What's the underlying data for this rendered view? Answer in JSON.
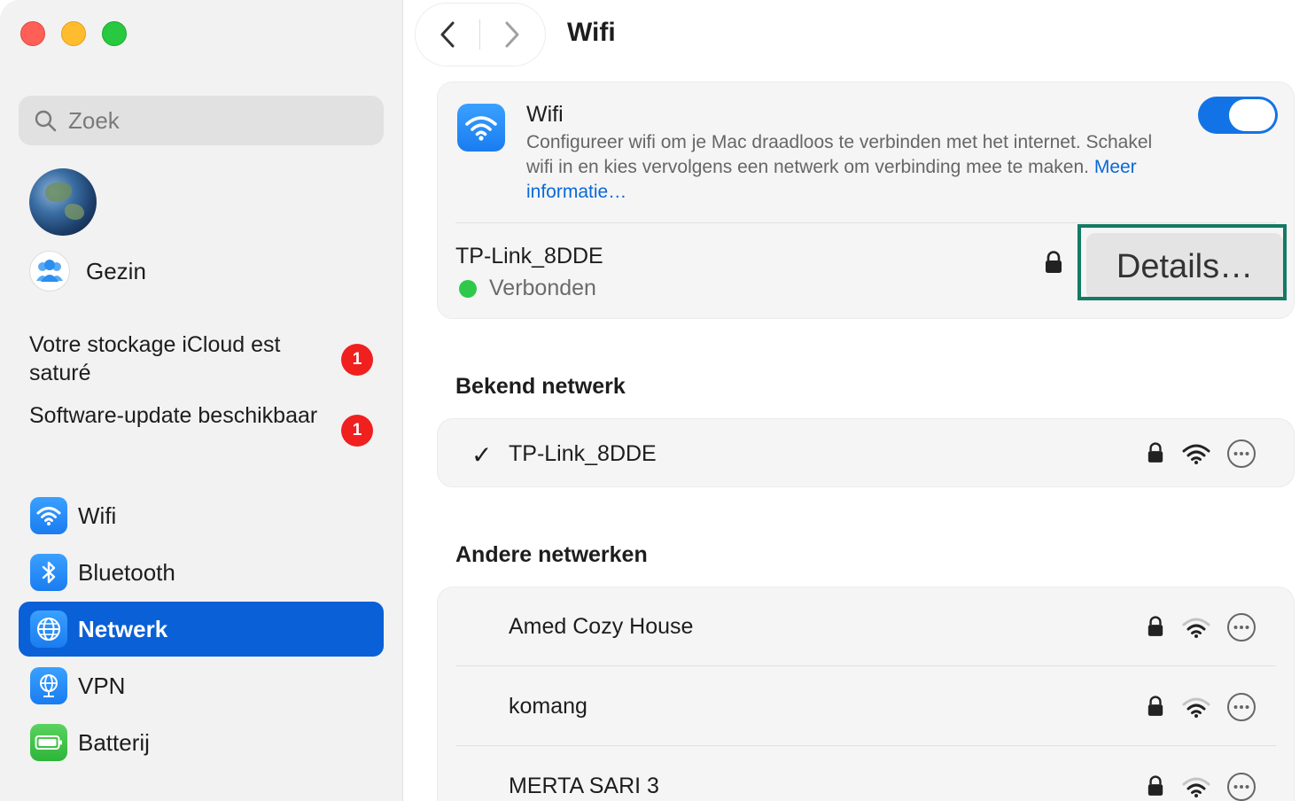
{
  "window": {
    "title": "Wifi"
  },
  "sidebar": {
    "search_placeholder": "Zoek",
    "family_label": "Gezin",
    "notices": [
      {
        "text": "Votre stockage iCloud est saturé",
        "badge": "1"
      },
      {
        "text": "Software-update beschikbaar",
        "badge": "1"
      }
    ],
    "items": [
      {
        "label": "Wifi",
        "icon": "wifi-icon"
      },
      {
        "label": "Bluetooth",
        "icon": "bluetooth-icon"
      },
      {
        "label": "Netwerk",
        "icon": "globe-icon",
        "active": true
      },
      {
        "label": "VPN",
        "icon": "vpn-globe-icon"
      },
      {
        "label": "Batterij",
        "icon": "battery-icon"
      }
    ]
  },
  "wifi": {
    "title": "Wifi",
    "description": "Configureer wifi om je Mac draadloos te verbinden met het internet. Schakel wifi in en kies vervolgens een netwerk om verbinding mee te maken.",
    "more_link": "Meer informatie…",
    "enabled": true,
    "current_network": "TP-Link_8DDE",
    "status": "Verbonden",
    "details_button": "Details…"
  },
  "known": {
    "title": "Bekend netwerk",
    "networks": [
      {
        "name": "TP-Link_8DDE",
        "checked": "✓"
      }
    ]
  },
  "others": {
    "title": "Andere netwerken",
    "networks": [
      {
        "name": "Amed Cozy House"
      },
      {
        "name": "komang"
      },
      {
        "name": "MERTA SARI 3"
      }
    ]
  },
  "colors": {
    "accent": "#0a60d6",
    "toggle_on": "#1273e6",
    "highlight": "#137a63",
    "connected_dot": "#2fc84b",
    "badge": "#f0201f"
  }
}
